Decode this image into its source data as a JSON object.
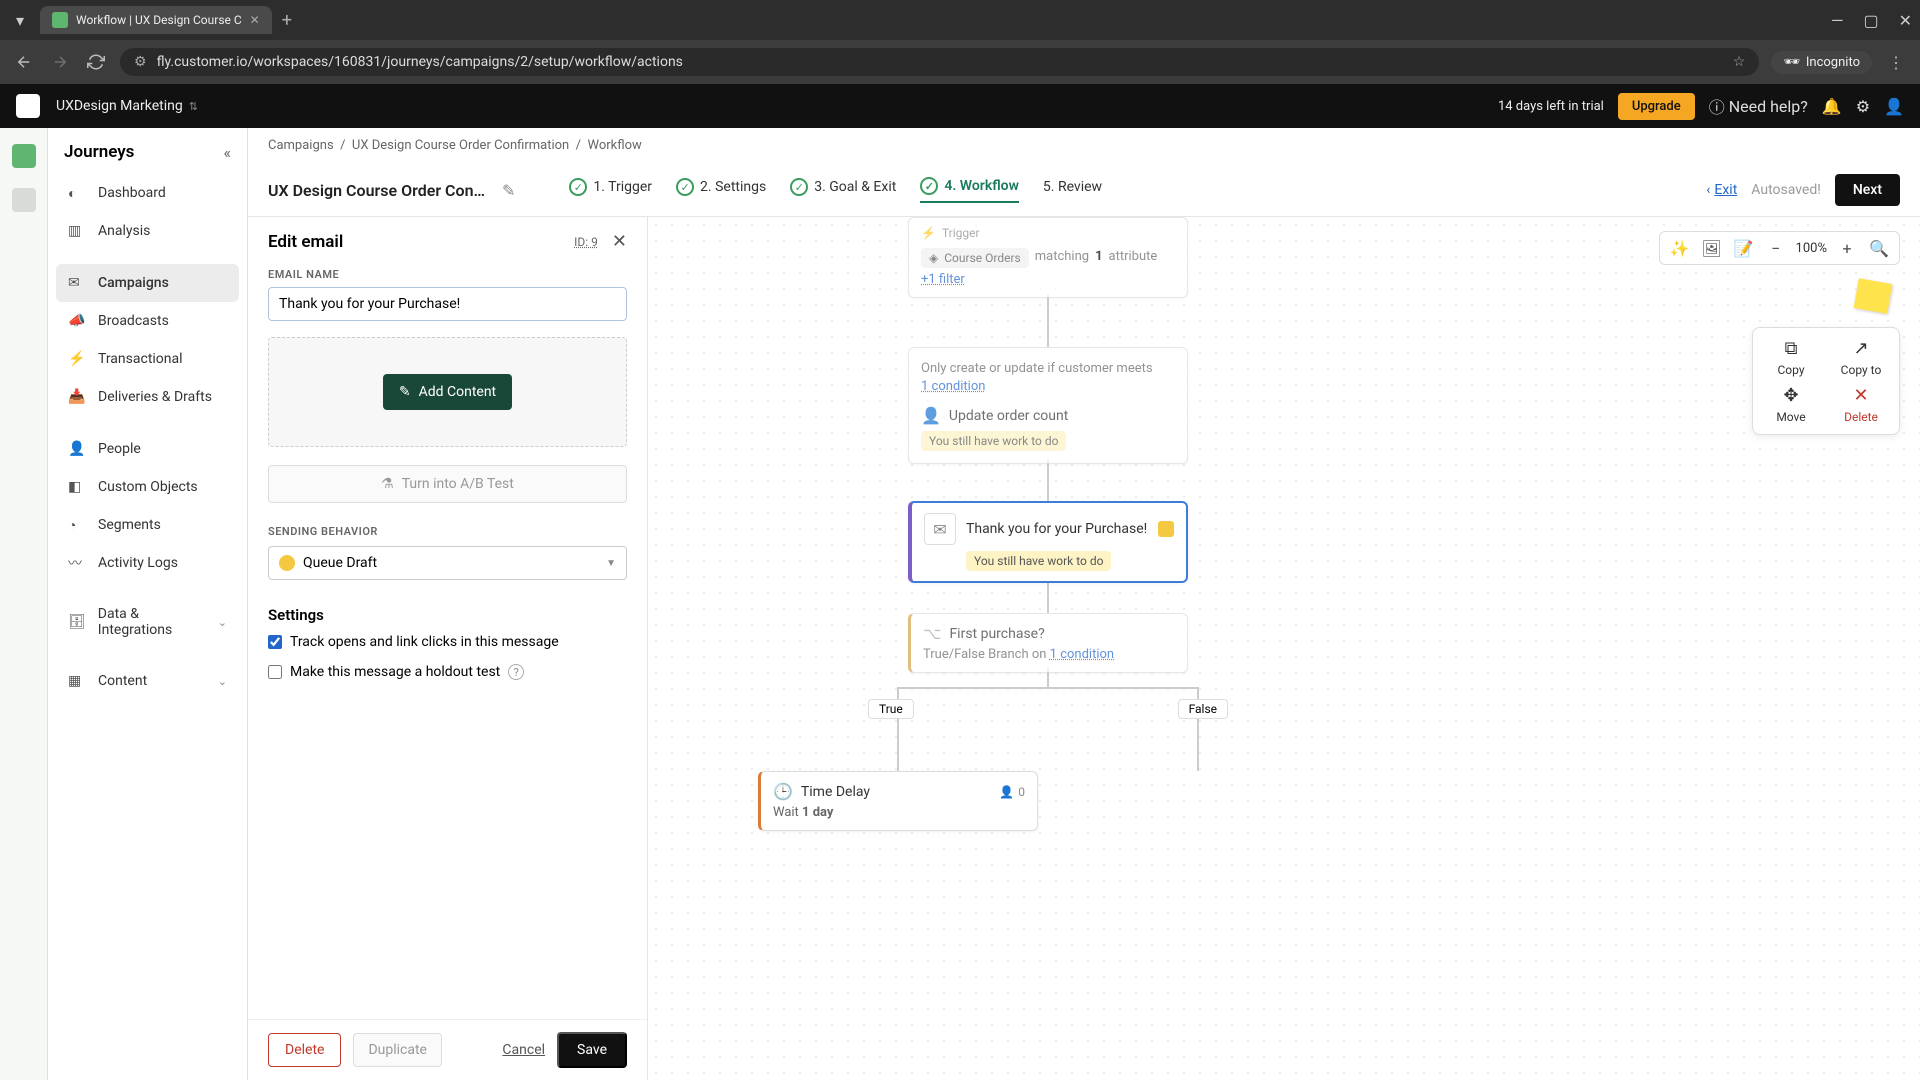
{
  "browser": {
    "tab_title": "Workflow | UX Design Course C",
    "url": "fly.customer.io/workspaces/160831/journeys/campaigns/2/setup/workflow/actions",
    "incognito": "Incognito"
  },
  "topbar": {
    "workspace": "UXDesign Marketing",
    "trial": "14 days left in trial",
    "upgrade": "Upgrade",
    "help": "Need help?"
  },
  "sidebar": {
    "title": "Journeys",
    "items": [
      {
        "label": "Dashboard"
      },
      {
        "label": "Analysis"
      },
      {
        "label": "Campaigns"
      },
      {
        "label": "Broadcasts"
      },
      {
        "label": "Transactional"
      },
      {
        "label": "Deliveries & Drafts"
      },
      {
        "label": "People"
      },
      {
        "label": "Custom Objects"
      },
      {
        "label": "Segments"
      },
      {
        "label": "Activity Logs"
      },
      {
        "label": "Data & Integrations"
      },
      {
        "label": "Content"
      }
    ]
  },
  "breadcrumb": {
    "a": "Campaigns",
    "b": "UX Design Course Order Confirmation",
    "c": "Workflow"
  },
  "header": {
    "title": "UX Design Course Order Confir…",
    "steps": {
      "s1": "1. Trigger",
      "s2": "2. Settings",
      "s3": "3. Goal & Exit",
      "s4": "4. Workflow",
      "s5": "5. Review"
    },
    "exit": "Exit",
    "autosaved": "Autosaved!",
    "next": "Next"
  },
  "edit": {
    "title": "Edit email",
    "id": "ID: 9",
    "email_name_label": "EMAIL NAME",
    "email_name_value": "Thank you for your Purchase! ",
    "add_content": "Add Content",
    "ab_test": "Turn into A/B Test",
    "sending_label": "SENDING BEHAVIOR",
    "sending_value": "Queue Draft",
    "settings_title": "Settings",
    "track_label": "Track opens and link clicks in this message",
    "holdout_label": "Make this message a holdout test",
    "delete": "Delete",
    "duplicate": "Duplicate",
    "cancel": "Cancel",
    "save": "Save"
  },
  "canvas": {
    "zoom": "100%",
    "trigger_label": "Trigger",
    "trigger_segment": "Course Orders",
    "trigger_match_a": "matching",
    "trigger_match_b": "1",
    "trigger_match_c": "attribute",
    "trigger_filter": "+1 filter",
    "update_cond_a": "Only create or update if customer meets",
    "update_cond_b": "1 condition",
    "update_title": "Update order count",
    "update_warn": "You still have work to do",
    "email_title": "Thank you for your Purchase!",
    "email_warn": "You still have work to do",
    "branch_title": "First purchase?",
    "branch_sub_a": "True/False Branch on",
    "branch_sub_b": "1 condition",
    "branch_true": "True",
    "branch_false": "False",
    "delay_title": "Time Delay",
    "delay_count": "0",
    "delay_wait_a": "Wait",
    "delay_wait_b": "1 day"
  },
  "palette": {
    "copy": "Copy",
    "copyto": "Copy to",
    "move": "Move",
    "delete": "Delete"
  }
}
